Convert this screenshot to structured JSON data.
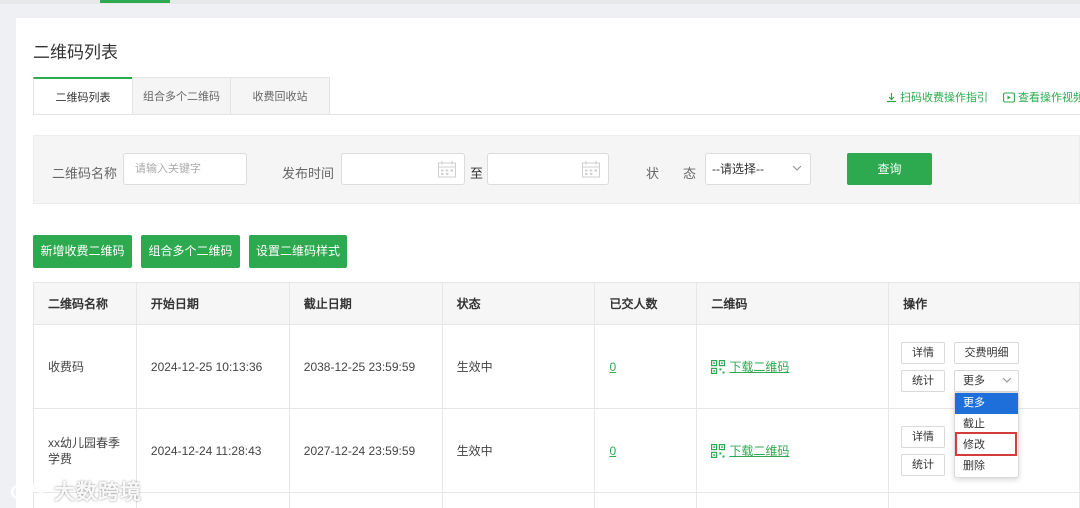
{
  "page": {
    "title": "二维码列表"
  },
  "tabs": [
    {
      "label": "二维码列表",
      "active": true
    },
    {
      "label": "组合多个二维码",
      "active": false
    },
    {
      "label": "收费回收站",
      "active": false
    }
  ],
  "help_links": {
    "guide": "扫码收费操作指引",
    "video": "查看操作视频"
  },
  "filter": {
    "name_label": "二维码名称",
    "name_placeholder": "请输入关键字",
    "date_label": "发布时间",
    "date_separator": "至",
    "status_label_1": "状",
    "status_label_2": "态",
    "status_selected": "--请选择--",
    "query_button": "查询"
  },
  "actions": {
    "add": "新增收费二维码",
    "combine": "组合多个二维码",
    "style": "设置二维码样式"
  },
  "table": {
    "headers": [
      "二维码名称",
      "开始日期",
      "截止日期",
      "状态",
      "已交人数",
      "二维码",
      "操作"
    ],
    "rows": [
      {
        "name": "收费码",
        "start": "2024-12-25 10:13:36",
        "end": "2038-12-25 23:59:59",
        "status": "生效中",
        "count": "0",
        "qr": "下载二维码"
      },
      {
        "name": "xx幼儿园春季学费",
        "start": "2024-12-24 11:28:43",
        "end": "2027-12-24 23:59:59",
        "status": "生效中",
        "count": "0",
        "qr": "下载二维码"
      }
    ]
  },
  "ops": {
    "detail": "详情",
    "payment_detail": "交费明细",
    "stats": "统计",
    "more": "更多"
  },
  "more_menu": [
    "更多",
    "截止",
    "修改",
    "删除"
  ],
  "watermark": "大数跨境",
  "colors": {
    "accent": "#2da94f",
    "menu_selected": "#1e6fd9",
    "highlight": "#d43b3b"
  }
}
